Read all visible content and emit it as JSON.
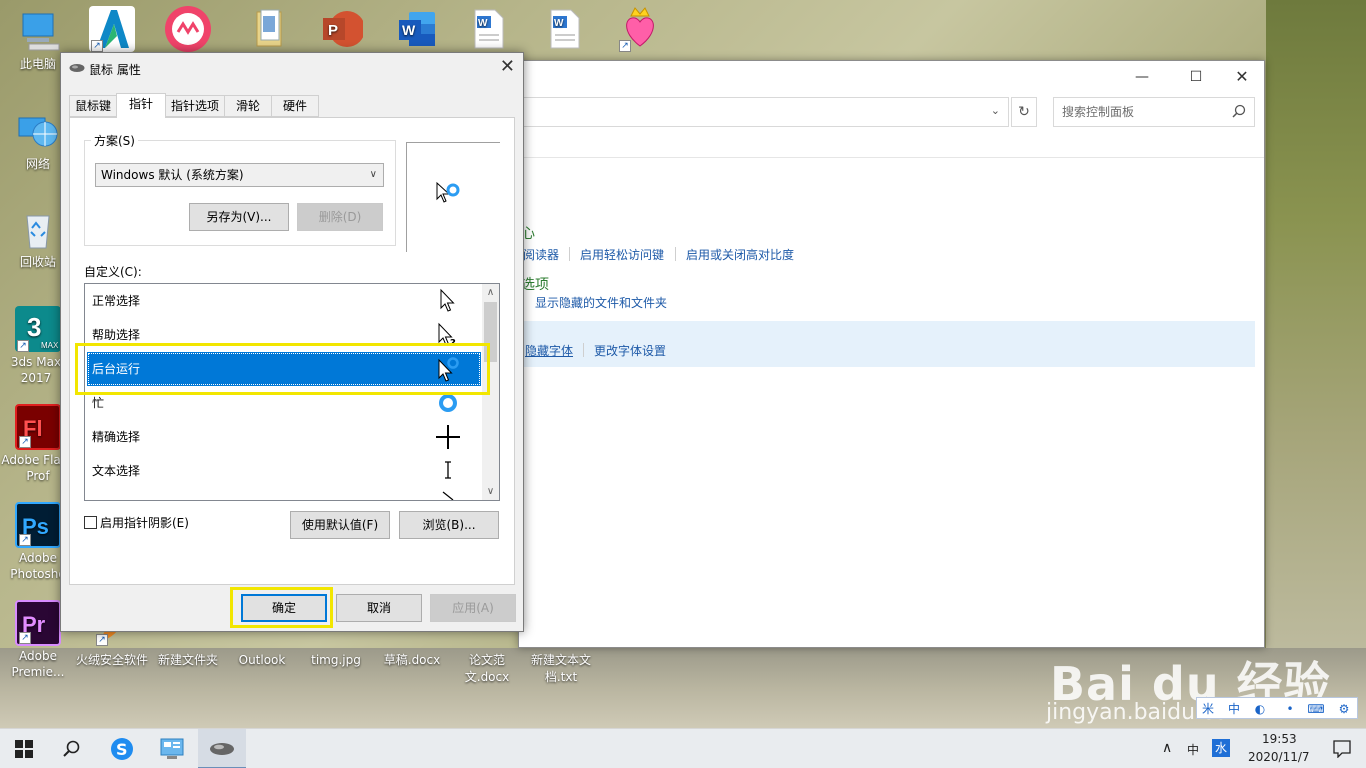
{
  "desktop": {
    "left_icons": [
      {
        "label": "此电脑"
      },
      {
        "label": "网络"
      },
      {
        "label": "回收站"
      },
      {
        "label": "3ds Max 2017"
      },
      {
        "label": "Adobe Flash Prof"
      },
      {
        "label": "Adobe Photosho"
      },
      {
        "label": "Adobe Premie..."
      }
    ],
    "bottom_labels": [
      "火绒安全软件",
      "新建文件夹",
      "Outlook",
      "timg.jpg",
      "草稿.docx",
      "论文范文.docx",
      "新建文本文档.txt"
    ]
  },
  "control_panel": {
    "search_placeholder": "搜索控制面板",
    "fragment_green_1": "心",
    "link_reader": "阅读器",
    "link_ease_keys": "启用轻松访问键",
    "link_high_contrast": "启用或关闭高对比度",
    "fragment_green_2": "选项",
    "link_hidden_files": "显示隐藏的文件和文件夹",
    "link_hidden_fonts": "隐藏字体",
    "link_font_settings": "更改字体设置"
  },
  "dialog": {
    "title": "鼠标 属性",
    "tabs": [
      "鼠标键",
      "指针",
      "指针选项",
      "滑轮",
      "硬件"
    ],
    "active_tab_index": 1,
    "scheme_label": "方案(S)",
    "scheme_value": "Windows 默认 (系统方案)",
    "save_as_label": "另存为(V)...",
    "delete_label": "删除(D)",
    "custom_label": "自定义(C):",
    "rows": [
      {
        "label": "正常选择",
        "cursor": "arrow-cursor-icon"
      },
      {
        "label": "帮助选择",
        "cursor": "help-cursor-icon"
      },
      {
        "label": "后台运行",
        "cursor": "working-cursor-icon",
        "selected": true
      },
      {
        "label": "忙",
        "cursor": "busy-ring-icon"
      },
      {
        "label": "精确选择",
        "cursor": "crosshair-cursor-icon"
      },
      {
        "label": "文本选择",
        "cursor": "ibeam-cursor-icon"
      }
    ],
    "shadow_label": "启用指针阴影(E)",
    "use_default_label": "使用默认值(F)",
    "browse_label": "浏览(B)...",
    "ok_label": "确定",
    "cancel_label": "取消",
    "apply_label": "应用(A)"
  },
  "ime": {
    "items": [
      "米",
      "中",
      "◐",
      "•",
      "⌨",
      "⚙"
    ]
  },
  "tray": {
    "lang": "中",
    "ime_icon": "水",
    "time": "19:53",
    "date": "2020/11/7"
  },
  "watermark": {
    "main": "Bai du 经验",
    "sub": "jingyan.baidu.com"
  },
  "colors": {
    "selection": "#0078d7",
    "highlight_box": "#f2e600",
    "link": "#1e5aa8"
  }
}
